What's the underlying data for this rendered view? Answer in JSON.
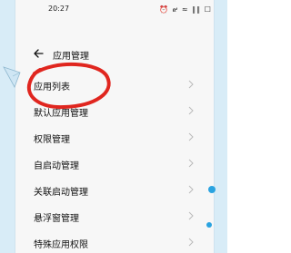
{
  "status_bar": {
    "time": "20:27",
    "icons": "⏰ ๙ ≈ ∥∥ ☐"
  },
  "title_bar": {
    "title": "应用管理"
  },
  "menu": {
    "items": [
      {
        "label": "应用列表"
      },
      {
        "label": "默认应用管理"
      },
      {
        "label": "权限管理"
      },
      {
        "label": "自启动管理"
      },
      {
        "label": "关联启动管理"
      },
      {
        "label": "悬浮窗管理"
      },
      {
        "label": "特殊应用权限"
      }
    ]
  },
  "colors": {
    "annotation_red": "#e0261f",
    "frame_blue": "#d8ecf7",
    "accent_blue": "#2aa3e0"
  }
}
